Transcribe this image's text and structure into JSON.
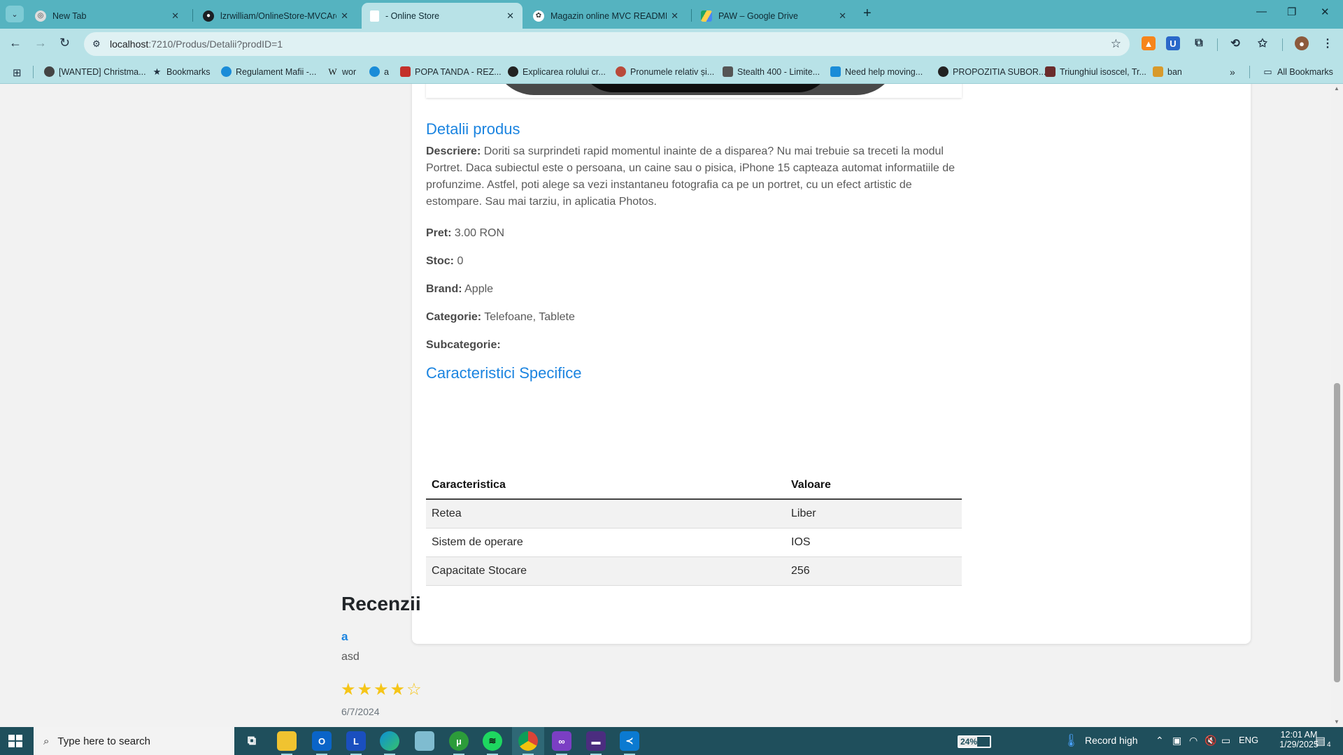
{
  "browser": {
    "tabs": [
      {
        "title": "New Tab",
        "active": false,
        "icon": "chrome-icon"
      },
      {
        "title": "lzrwilliam/OnlineStore-MVCArc",
        "active": false,
        "icon": "github-icon"
      },
      {
        "title": "- Online Store",
        "active": true,
        "icon": "page-icon"
      },
      {
        "title": "Magazin online MVC README",
        "active": false,
        "icon": "chatgpt-icon"
      },
      {
        "title": "PAW – Google Drive",
        "active": false,
        "icon": "drive-icon"
      }
    ],
    "url_host": "localhost",
    "url_path": ":7210/Produs/Detalii?prodID=1",
    "bookmarks": [
      {
        "label": "[WANTED] Christma...",
        "icon": "bookmark-site-icon"
      },
      {
        "label": "Bookmarks",
        "icon": "star-icon"
      },
      {
        "label": "Regulament Mafii -...",
        "icon": "bookmark-site-icon"
      },
      {
        "label": "wor",
        "icon": "wikipedia-icon"
      },
      {
        "label": "a",
        "icon": "bookmark-site-icon"
      },
      {
        "label": "POPA TANDA - REZ...",
        "icon": "bookmark-site-icon"
      },
      {
        "label": "Explicarea rolului cr...",
        "icon": "bookmark-site-icon"
      },
      {
        "label": "Pronumele relativ și...",
        "icon": "bookmark-site-icon"
      },
      {
        "label": "Stealth 400 - Limite...",
        "icon": "bookmark-site-icon"
      },
      {
        "label": "Need help moving...",
        "icon": "bookmark-site-icon"
      },
      {
        "label": "PROPOZITIA SUBOR...",
        "icon": "bookmark-site-icon"
      },
      {
        "label": "Triunghiul isoscel, Tr...",
        "icon": "bookmark-site-icon"
      },
      {
        "label": "ban",
        "icon": "bookmark-site-icon"
      }
    ],
    "all_bookmarks": "All Bookmarks"
  },
  "product": {
    "details_heading": "Detalii produs",
    "description_label": "Descriere:",
    "description": "Doriti sa surprindeti rapid momentul inainte de a disparea? Nu mai trebuie sa treceti la modul Portret. Daca subiectul este o persoana, un caine sau o pisica, iPhone 15 capteaza automat informatiile de profunzime. Astfel, poti alege sa vezi instantaneu fotografia ca pe un portret, cu un efect artistic de estompare. Sau mai tarziu, in aplicatia Photos.",
    "price_label": "Pret:",
    "price": "3.00 RON",
    "stock_label": "Stoc:",
    "stock": "0",
    "brand_label": "Brand:",
    "brand": "Apple",
    "category_label": "Categorie:",
    "category": "Telefoane, Tablete",
    "subcategory_label": "Subcategorie:",
    "subcategory": "",
    "specs_heading": "Caracteristici Specifice",
    "specs_columns": [
      "Caracteristica",
      "Valoare"
    ],
    "specs_rows": [
      [
        "Retea",
        "Liber"
      ],
      [
        "Sistem de operare",
        "IOS"
      ],
      [
        "Capacitate Stocare",
        "256"
      ]
    ]
  },
  "reviews": {
    "heading": "Recenzii",
    "items": [
      {
        "author": "a",
        "text": "asd",
        "stars": "★★★★☆",
        "rating": 4,
        "max_rating": 5,
        "date": "6/7/2024"
      }
    ]
  },
  "taskbar": {
    "search_placeholder": "Type here to search",
    "battery": "24%",
    "weather": "Record high",
    "language": "ENG",
    "time": "12:01 AM",
    "date": "1/29/2025",
    "notifications": "4"
  },
  "colors": {
    "accent": "#1b84e0",
    "chrome": "#55b3c0",
    "toolbar": "#b8e2e7",
    "star": "#f5c518",
    "taskbar": "#1f4f5c"
  }
}
